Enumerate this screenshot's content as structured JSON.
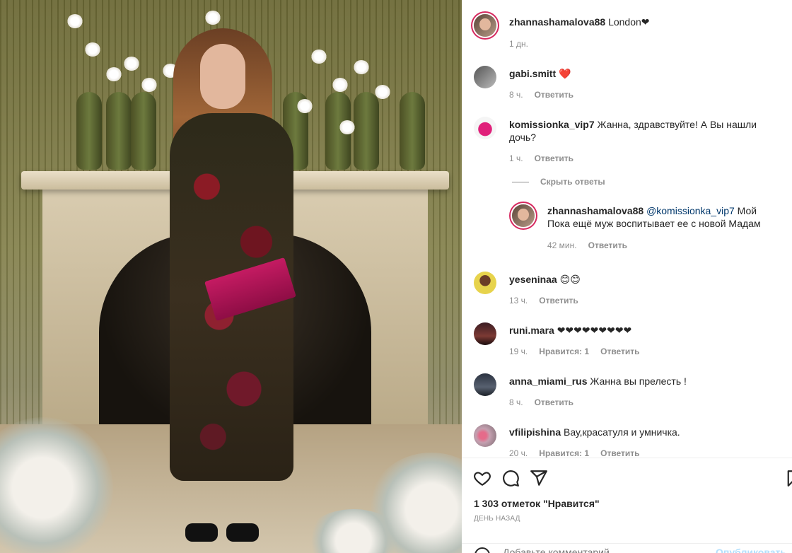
{
  "post": {
    "author": "zhannashamalova88",
    "caption": "London❤",
    "time": "1 дн."
  },
  "comments": [
    {
      "user": "gabi.smitt",
      "text": "❤️",
      "time": "8 ч.",
      "reply_label": "Ответить"
    },
    {
      "user": "komissionka_vip7",
      "text": "Жанна, здравствуйте! А Вы нашли дочь?",
      "time": "1 ч.",
      "reply_label": "Ответить"
    },
    {
      "user": "yeseninaa",
      "text": "😊😊",
      "time": "13 ч.",
      "reply_label": "Ответить"
    },
    {
      "user": "runi.mara",
      "text": "❤❤❤❤❤❤❤❤❤",
      "time": "19 ч.",
      "likes": "Нравится: 1",
      "reply_label": "Ответить"
    },
    {
      "user": "anna_miami_rus",
      "text": "Жанна вы прелесть !",
      "time": "8 ч.",
      "reply_label": "Ответить"
    },
    {
      "user": "vfilipishina",
      "text": "Вау,красатуля и умничка.",
      "time": "20 ч.",
      "likes": "Нравится: 1",
      "reply_label": "Ответить"
    }
  ],
  "hide_replies": "Скрыть ответы",
  "reply": {
    "user": "zhannashamalova88",
    "mention": "@komissionka_vip7",
    "text_line1": "Мой",
    "text_line2": "Пока ещё муж воспитывает ее с новой Мадам",
    "time": "42 мин.",
    "reply_label": "Ответить"
  },
  "actions": {
    "icons": [
      "heart-icon",
      "comment-icon",
      "share-icon",
      "bookmark-icon"
    ],
    "likes": "1 303 отметок \"Нравится\"",
    "posted": "ДЕНЬ НАЗАД",
    "comment_placeholder": "Добавьте комментарий...",
    "post_label": "Опубликовать"
  },
  "colors": {
    "ring": "#d6295f",
    "meta": "#8e8e8e",
    "mention": "#00376b",
    "post_button": "#b2dffc"
  }
}
